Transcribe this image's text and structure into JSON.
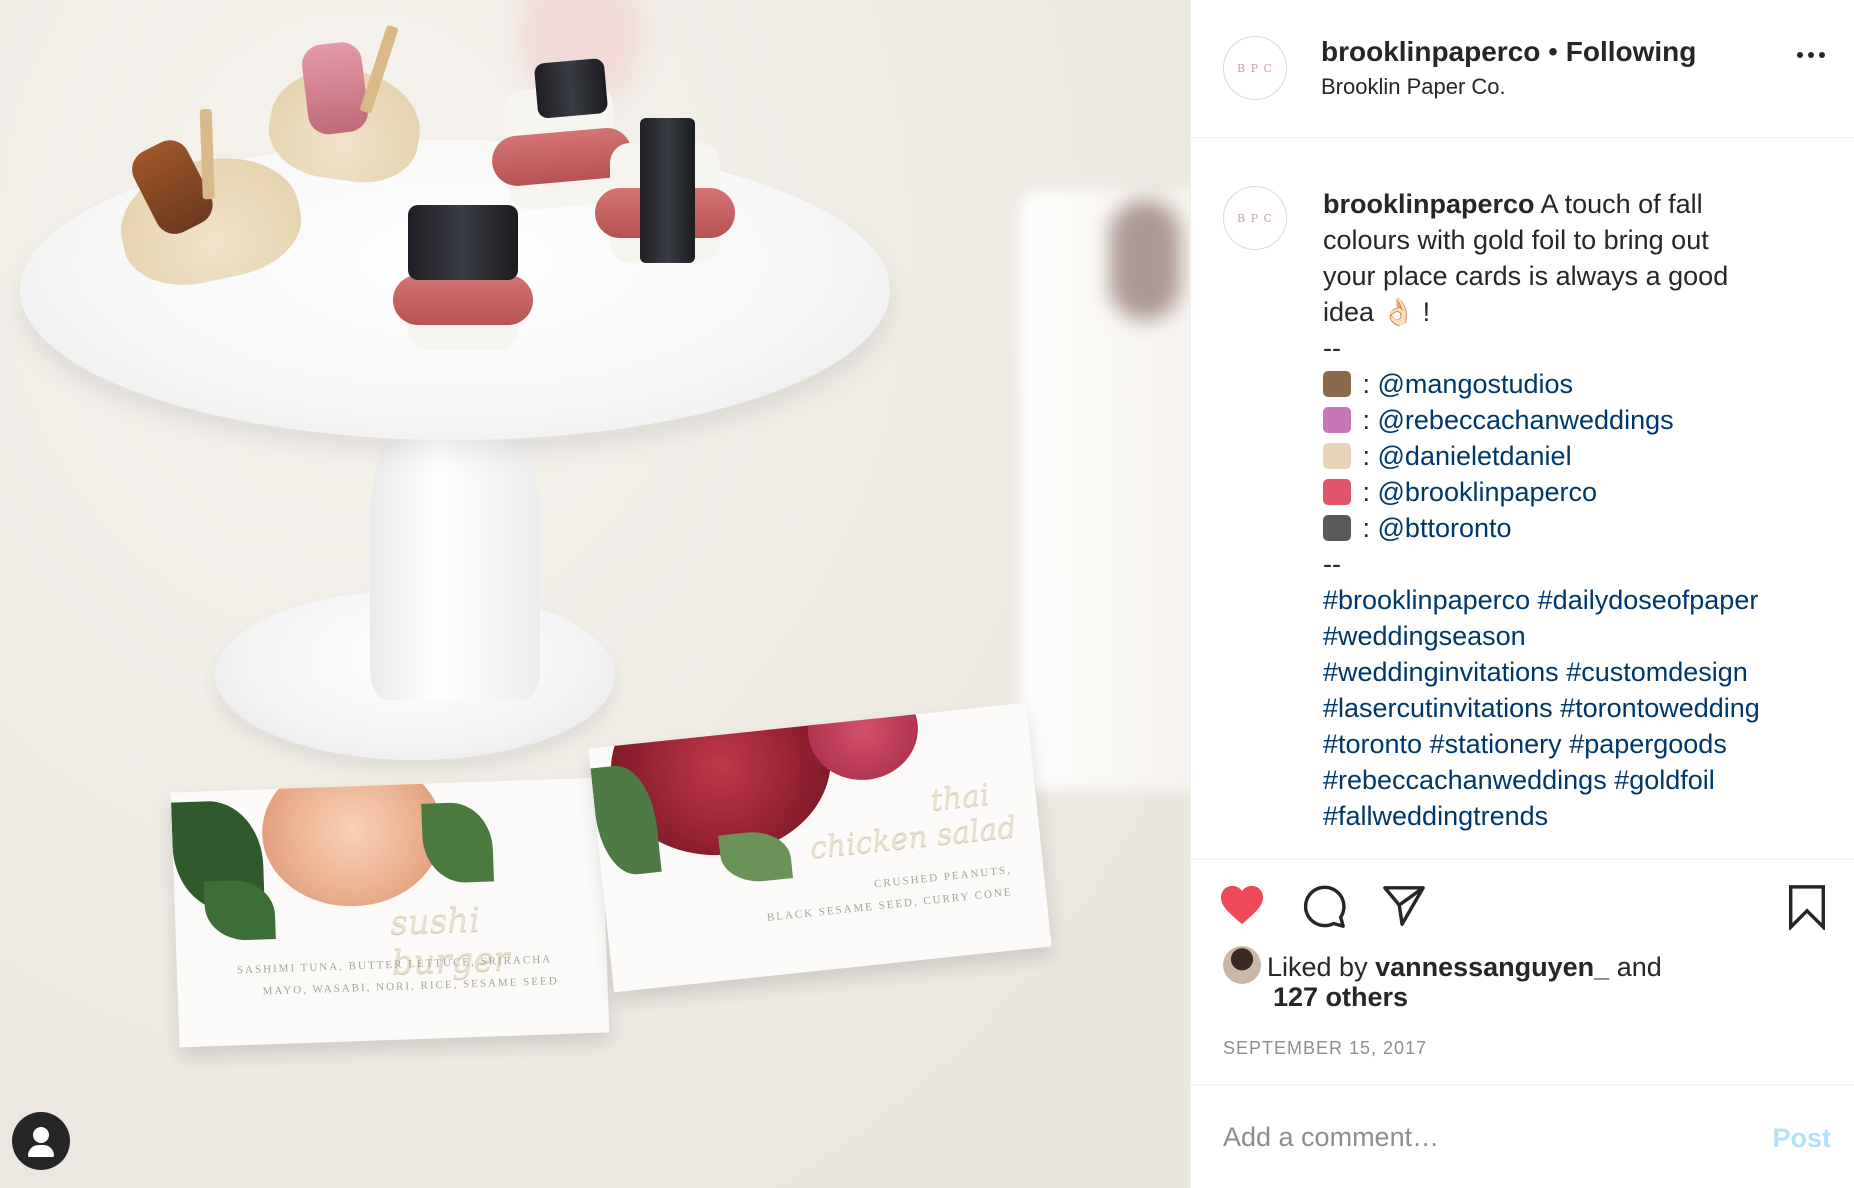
{
  "post": {
    "username": "brooklinpaperco",
    "separator": "•",
    "follow_status": "Following",
    "location": "Brooklin Paper Co.",
    "avatar_monogram": "B P C"
  },
  "caption": {
    "username": "brooklinpaperco",
    "lines": [
      {
        "type": "text",
        "text": "A touch of fall"
      },
      {
        "type": "text",
        "text": "colours with gold foil to bring out"
      },
      {
        "type": "text",
        "text": "your place cards is always a good"
      },
      {
        "type": "text",
        "text": "idea 👌🏻 !"
      },
      {
        "type": "text",
        "text": "--"
      }
    ],
    "credits": [
      {
        "icon": "camera-flash-icon",
        "color": "#8a6a4a",
        "sep": " : ",
        "handle": "@mangostudios"
      },
      {
        "icon": "woman-tipping-hand-icon",
        "color": "#c678b6",
        "sep": " : ",
        "handle": "@rebeccachanweddings"
      },
      {
        "icon": "chef-icon",
        "color": "#e8d2b8",
        "sep": " : ",
        "handle": "@danieletdaniel"
      },
      {
        "icon": "love-letter-icon",
        "color": "#e0556b",
        "sep": " : ",
        "handle": "@brooklinpaperco"
      },
      {
        "icon": "television-icon",
        "color": "#5a5a5a",
        "sep": " : ",
        "handle": "@bttoronto"
      }
    ],
    "divider": "--",
    "hashtag_lines": [
      [
        "#brooklinpaperco",
        "#dailydoseofpaper"
      ],
      [
        "#weddingseason"
      ],
      [
        "#weddinginvitations",
        "#customdesign"
      ],
      [
        "#lasercutinvitations",
        "#torontowedding"
      ],
      [
        "#toronto",
        "#stationery",
        "#papergoods"
      ],
      [
        "#rebeccachanweddings",
        "#goldfoil"
      ],
      [
        "#fallweddingtrends"
      ]
    ]
  },
  "actions": {
    "like_color": "#ed4956",
    "liked_prefix": "Liked by",
    "liked_user": "vannessanguyen_",
    "liked_suffix": "and",
    "others": "127 others",
    "date": "SEPTEMBER 15, 2017"
  },
  "comment": {
    "placeholder": "Add a comment…",
    "post_label": "Post"
  },
  "photo": {
    "card1": {
      "title": "sushi burger",
      "sub1": "sashimi tuna, butter lettuce, sriracha",
      "sub2": "mayo, wasabi, nori, rice, sesame seed"
    },
    "card2": {
      "title1": "thai",
      "title2": "chicken salad",
      "sub1": "crushed peanuts,",
      "sub2": "black sesame seed, curry cone"
    }
  }
}
